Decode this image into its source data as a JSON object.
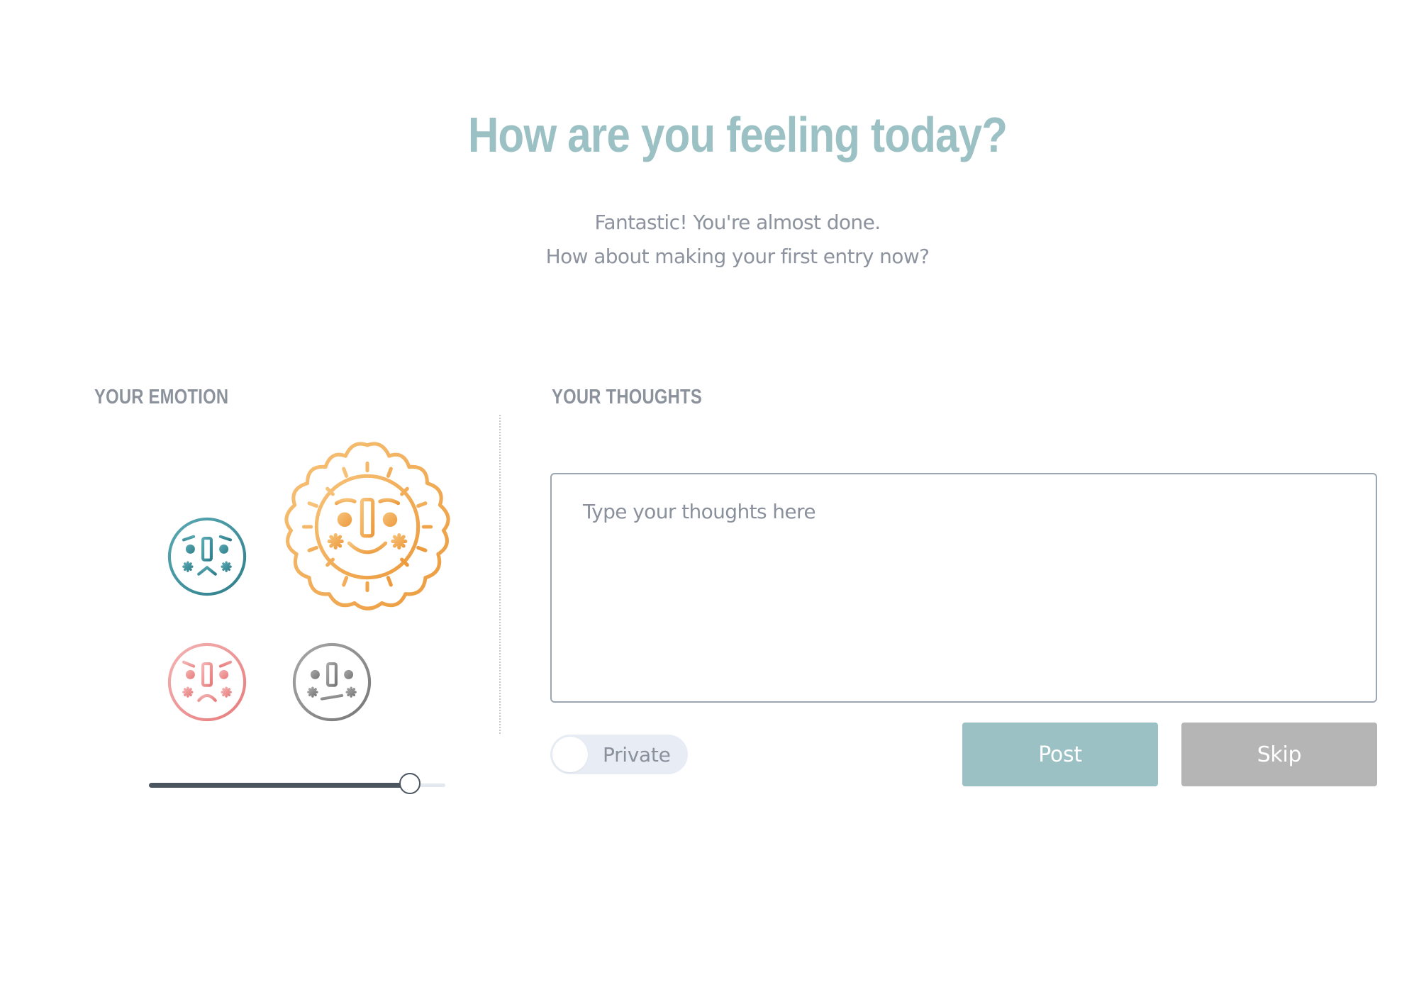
{
  "header": {
    "title": "How are you feeling today?",
    "subtitle_line1": "Fantastic! You're almost done.",
    "subtitle_line2": "How about making your first entry now?"
  },
  "emotion": {
    "label": "YOUR EMOTION",
    "faces": [
      {
        "name": "sad",
        "icon": "sad-face-icon",
        "color": "#3e8f9a"
      },
      {
        "name": "happy",
        "icon": "sun-face-icon",
        "color": "#f0aa50",
        "selected": true
      },
      {
        "name": "angry",
        "icon": "angry-face-icon",
        "color": "#ee8c8c"
      },
      {
        "name": "neutral",
        "icon": "neutral-face-icon",
        "color": "#8a8a8a"
      }
    ],
    "intensity": 0.88
  },
  "thoughts": {
    "label": "YOUR THOUGHTS",
    "placeholder": "Type your thoughts here",
    "value": ""
  },
  "privacy": {
    "label": "Private",
    "on": false
  },
  "actions": {
    "post_label": "Post",
    "skip_label": "Skip"
  },
  "colors": {
    "accent": "#9bc1c4",
    "muted_button": "#b5b5b5",
    "text_muted": "#8c939e"
  }
}
